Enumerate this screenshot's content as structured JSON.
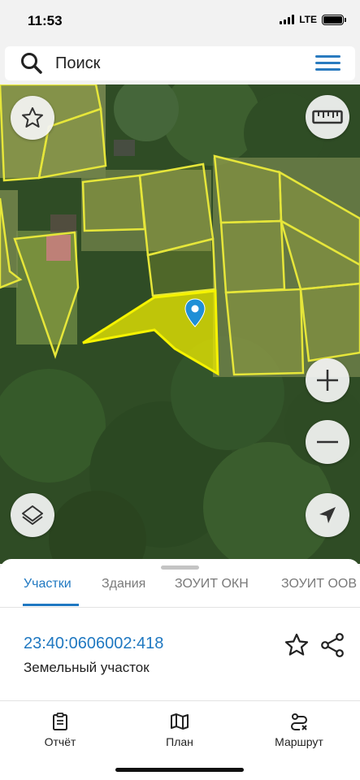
{
  "status_bar": {
    "time": "11:53",
    "network": "LTE"
  },
  "search": {
    "label": "Поиск",
    "icon": "search-icon",
    "menu_icon": "hamburger-menu-icon",
    "accent_color": "#2a7bbf"
  },
  "map": {
    "type": "satellite",
    "selected_parcel_color": "#f3f000",
    "parcel_outline_color": "#e3e23a",
    "marker_color": "#1f8fd6",
    "buttons": {
      "favorite": "star-icon",
      "ruler": "ruler-icon",
      "zoom_in": "plus-icon",
      "zoom_out": "minus-icon",
      "layers": "layers-icon",
      "locate": "location-arrow-icon"
    }
  },
  "sheet": {
    "tabs": [
      {
        "label": "Участки",
        "active": true
      },
      {
        "label": "Здания",
        "active": false
      },
      {
        "label": "ЗОУИТ ОКН",
        "active": false
      },
      {
        "label": "ЗОУИТ ООВ",
        "active": false
      }
    ],
    "parcel": {
      "cadastral_number": "23:40:0606002:418",
      "type": "Земельный участок"
    }
  },
  "bottom_nav": [
    {
      "label": "Отчёт",
      "icon": "report-icon"
    },
    {
      "label": "План",
      "icon": "map-plan-icon"
    },
    {
      "label": "Маршрут",
      "icon": "route-icon"
    }
  ],
  "colors": {
    "accent": "#1f78c1"
  }
}
